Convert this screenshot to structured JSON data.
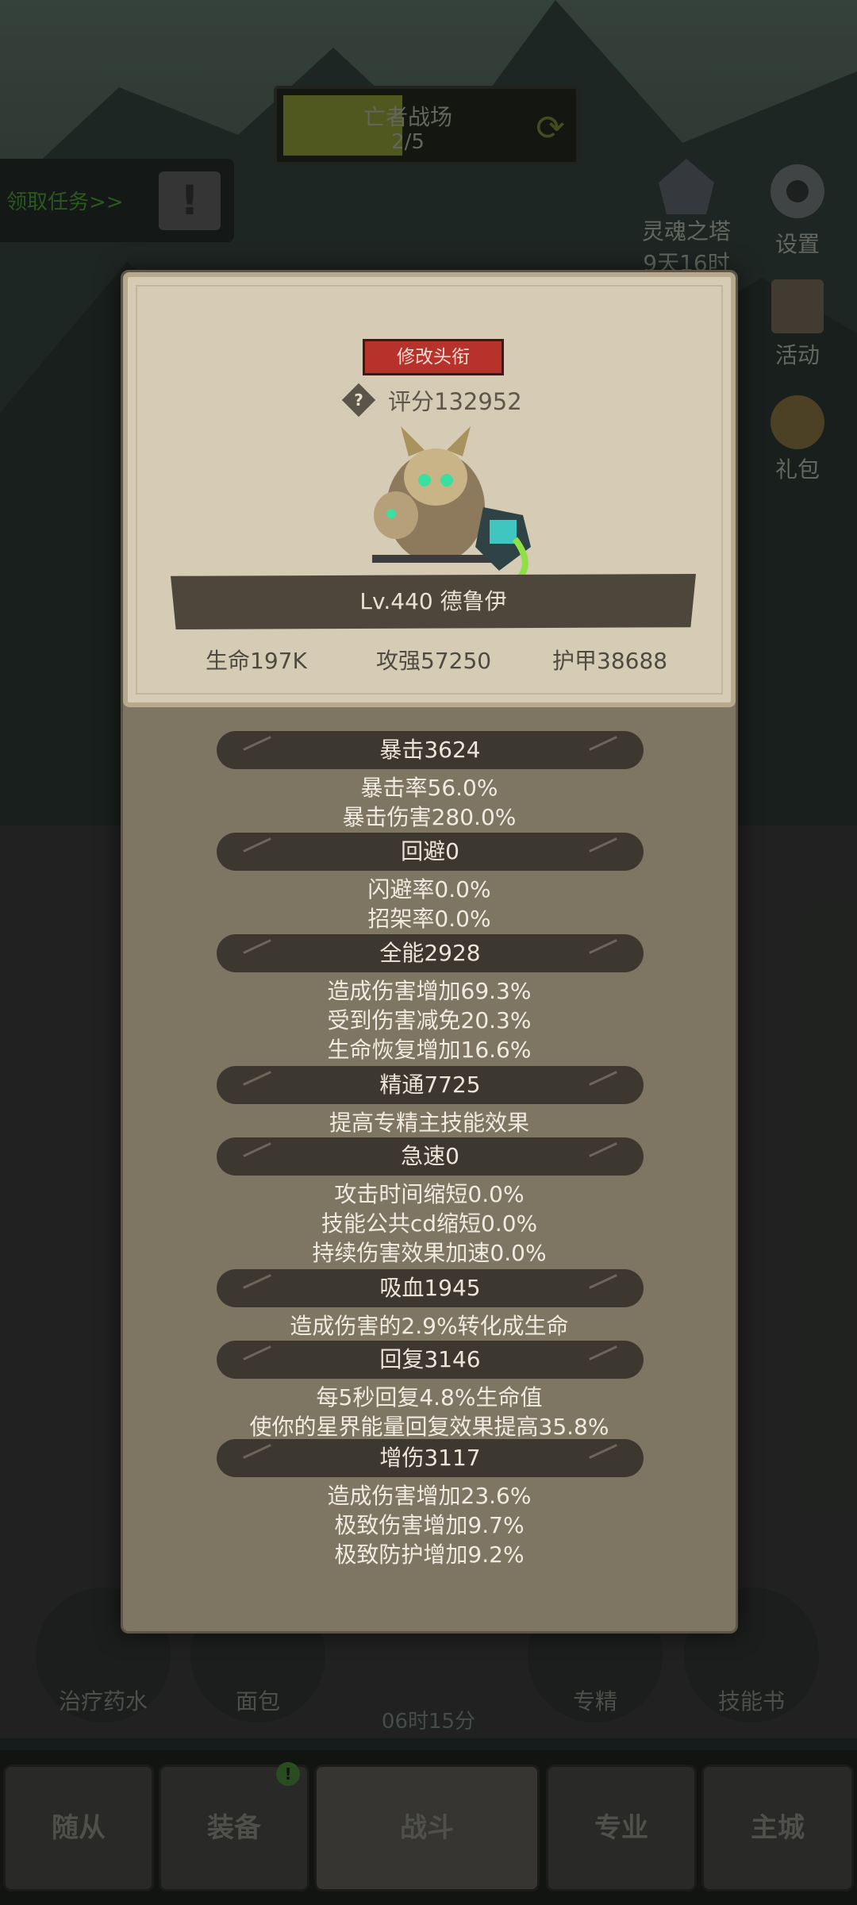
{
  "battle_banner": {
    "title": "亡者战场",
    "progress": "2/5"
  },
  "quest": {
    "label": "领取任务>>",
    "alert": "!"
  },
  "side_buttons": {
    "soul_tower": {
      "label": "灵魂之塔",
      "timer": "9天16时"
    },
    "settings": {
      "label": "设置"
    },
    "activity": {
      "label": "活动"
    },
    "gift": {
      "label": "礼包"
    }
  },
  "bottom_items": [
    {
      "label": "治疗药水"
    },
    {
      "label": "面包"
    },
    {
      "label": "专精"
    },
    {
      "label": "技能书"
    }
  ],
  "treasure_timer": "06时15分",
  "tabs": [
    {
      "label": "随从"
    },
    {
      "label": "装备"
    },
    {
      "label": "战斗"
    },
    {
      "label": "专业"
    },
    {
      "label": "主城"
    }
  ],
  "tab_badge": "!",
  "modal": {
    "title_button": "修改头衔",
    "score_icon": "?",
    "score": "评分132952",
    "name": "Lv.440 德鲁伊",
    "basic_stats": {
      "hp": "生命197K",
      "attack": "攻强57250",
      "armor": "护甲38688"
    },
    "sections": [
      {
        "header": "暴击3624",
        "lines": [
          "暴击率56.0%",
          "暴击伤害280.0%"
        ]
      },
      {
        "header": "回避0",
        "lines": [
          "闪避率0.0%",
          "招架率0.0%"
        ]
      },
      {
        "header": "全能2928",
        "lines": [
          "造成伤害增加69.3%",
          "受到伤害减免20.3%",
          "生命恢复增加16.6%"
        ]
      },
      {
        "header": "精通7725",
        "lines": [
          "提高专精主技能效果"
        ]
      },
      {
        "header": "急速0",
        "lines": [
          "攻击时间缩短0.0%",
          "技能公共cd缩短0.0%",
          "持续伤害效果加速0.0%"
        ]
      },
      {
        "header": "吸血1945",
        "lines": [
          "造成伤害的2.9%转化成生命"
        ]
      },
      {
        "header": "回复3146",
        "lines": [
          "每5秒回复4.8%生命值",
          "使你的星界能量回复效果提高35.8%"
        ]
      },
      {
        "header": "增伤3117",
        "lines": [
          "造成伤害增加23.6%",
          "极致伤害增加9.7%",
          "极致防护增加9.2%"
        ]
      }
    ]
  }
}
